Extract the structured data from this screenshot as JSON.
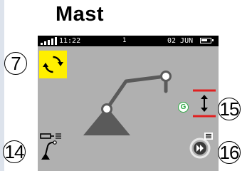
{
  "page": {
    "title": "Mast"
  },
  "status_bar": {
    "time": "11:22",
    "center_indicator": "1",
    "date": "02 JUN"
  },
  "callouts": {
    "rotate_mode": "7",
    "mast_lift": "15",
    "boom_tilt": "14",
    "fast_forward": "16"
  },
  "controls": {
    "speed_badge": "G"
  },
  "icons": {
    "rotate_mode": "rotate-arrows-icon",
    "mast_lift": "up-down-arrow-icon",
    "boom_tilt": "boom-tilt-icon",
    "fast_forward": "fast-forward-icon",
    "signal": "signal-icon",
    "battery": "battery-icon",
    "speed_badge": "lock-badge-icon"
  },
  "colors": {
    "screen": "#b0b0b0",
    "status_bar": "#000000",
    "accent_yellow": "#ffef00",
    "limit_red": "#e02020",
    "badge_green": "#2eaa44",
    "mast_dark": "#5a5a5a",
    "joint_white": "#ffffff"
  }
}
